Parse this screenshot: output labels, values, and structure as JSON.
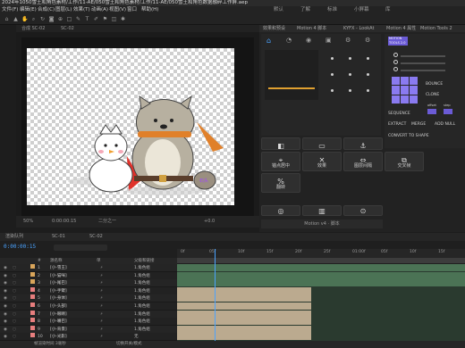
{
  "window_title": "2024年1050雪王和角色素材/工作/11-AE/050雪王和角色素材/工作/11-AE/050雪王和角色数据融碎工作屏.aep",
  "menu": [
    "文件(F)",
    "编辑(E)",
    "合成(C)",
    "图层(L)",
    "效果(T)",
    "动画(A)",
    "视图(V)",
    "窗口",
    "帮助(H)"
  ],
  "workspaces": [
    "默认",
    "了解",
    "标准",
    "小屏幕",
    "库"
  ],
  "composition": {
    "tabs": [
      "合成 SC-02",
      "SC-02"
    ],
    "zoom": "50%",
    "timecode": "0:00:00:15",
    "resolution": "二分之一",
    "timecode_bar": "+0.0"
  },
  "right_panel": {
    "top_tabs": [
      "效果和预设",
      "Motion 4 脚本",
      "KYFX - LookAt"
    ],
    "motion_tabs": [
      "Motion 4 属性",
      "Motion Tools 2"
    ],
    "motion_label": "Motion v4 · 脚本",
    "buttons": [
      {
        "label": "锚点居中",
        "icon": "anchor-icon"
      },
      {
        "label": "效果",
        "icon": "fx-icon"
      },
      {
        "label": "图层间隔",
        "icon": "spacing-icon"
      },
      {
        "label": "交叉帧",
        "icon": "cross-icon"
      },
      {
        "label": "翻转",
        "icon": "percent-icon"
      }
    ],
    "tools": {
      "title": "MOTION TOOLS 2.0",
      "labels": [
        "SEQUENCE",
        "EXTRACT",
        "MERGE",
        "ADD NULL",
        "CONVERT TO SHAPE",
        "BOUNCE",
        "CLONE",
        "offset",
        "step"
      ]
    },
    "accent_color": "#6b5bd6"
  },
  "timeline": {
    "tabs": [
      "渲染队列",
      "SC-01",
      "SC-02"
    ],
    "timecode": "0:00:00:15",
    "columns": [
      "#",
      "源名称",
      "单",
      "父级和链接"
    ],
    "layers": [
      {
        "num": "1",
        "name": "[小-雪王]",
        "parent": "1.角色组",
        "color": "#d9a55a"
      },
      {
        "num": "2",
        "name": "[小-猫咪]",
        "parent": "1.角色组",
        "color": "#d9a55a"
      },
      {
        "num": "3",
        "name": "[小-尾巴]",
        "parent": "1.角色组",
        "color": "#d9a55a"
      },
      {
        "num": "4",
        "name": "[小-手臂]",
        "parent": "1.角色组",
        "color": "#e77e7e"
      },
      {
        "num": "5",
        "name": "[小-身体]",
        "parent": "1.角色组",
        "color": "#e77e7e"
      },
      {
        "num": "6",
        "name": "[小-头部]",
        "parent": "1.角色组",
        "color": "#e77e7e"
      },
      {
        "num": "7",
        "name": "[小-眼睛]",
        "parent": "1.角色组",
        "color": "#e77e7e"
      },
      {
        "num": "8",
        "name": "[小-嘴巴]",
        "parent": "1.角色组",
        "color": "#e77e7e"
      },
      {
        "num": "9",
        "name": "[小-背景]",
        "parent": "1.角色组",
        "color": "#e77e7e"
      },
      {
        "num": "10",
        "name": "[小-光影]",
        "parent": "无",
        "color": "#e77e7e"
      }
    ],
    "ruler": [
      "0f",
      "05f",
      "10f",
      "15f",
      "20f",
      "25f",
      "01:00f",
      "05f",
      "10f",
      "15f"
    ],
    "footer": [
      "帧渲染时间 3毫秒",
      "切换开关/模式"
    ]
  }
}
